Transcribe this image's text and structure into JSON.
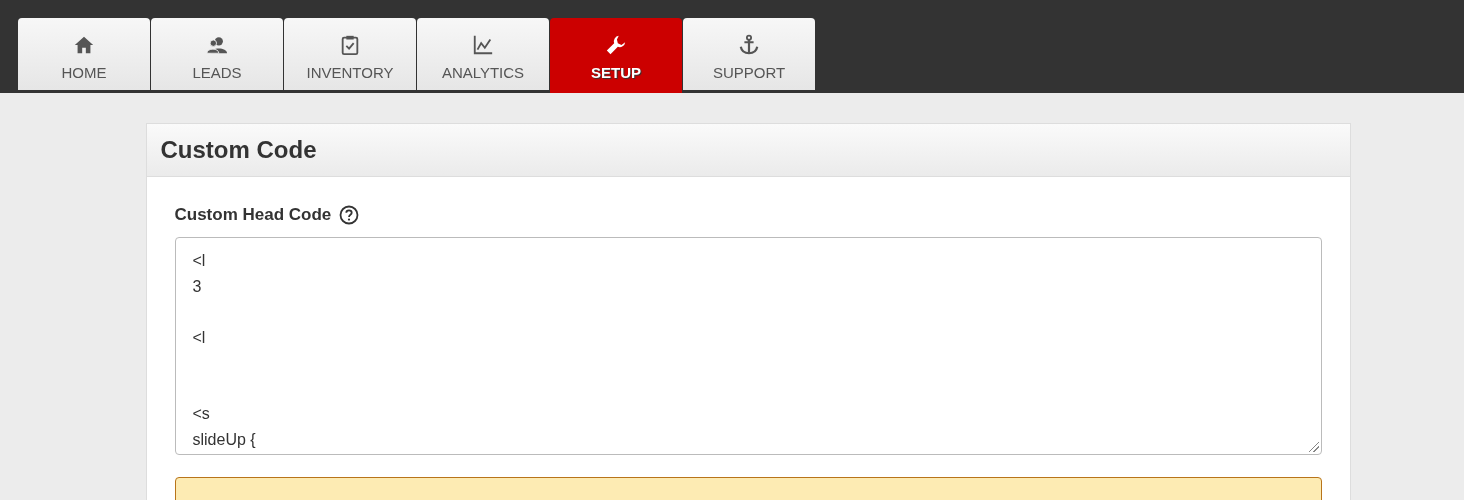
{
  "tabs": [
    {
      "label": "HOME",
      "selected": false
    },
    {
      "label": "LEADS",
      "selected": false
    },
    {
      "label": "INVENTORY",
      "selected": false
    },
    {
      "label": "ANALYTICS",
      "selected": false
    },
    {
      "label": "SETUP",
      "selected": true
    },
    {
      "label": "SUPPORT",
      "selected": false
    }
  ],
  "panel": {
    "title": "Custom Code",
    "field": {
      "label": "Custom Head Code",
      "help": true,
      "lines": [
        {
          "text": "<l",
          "kind": "line"
        },
        {
          "text": "3",
          "kind": "line"
        },
        {
          "text": "<l",
          "kind": "after-blank"
        },
        {
          "text": "<s",
          "kind": "after-two-blanks"
        },
        {
          "text": "slideUp {",
          "kind": "line"
        }
      ]
    },
    "alert": {
      "kind": "warning"
    }
  }
}
